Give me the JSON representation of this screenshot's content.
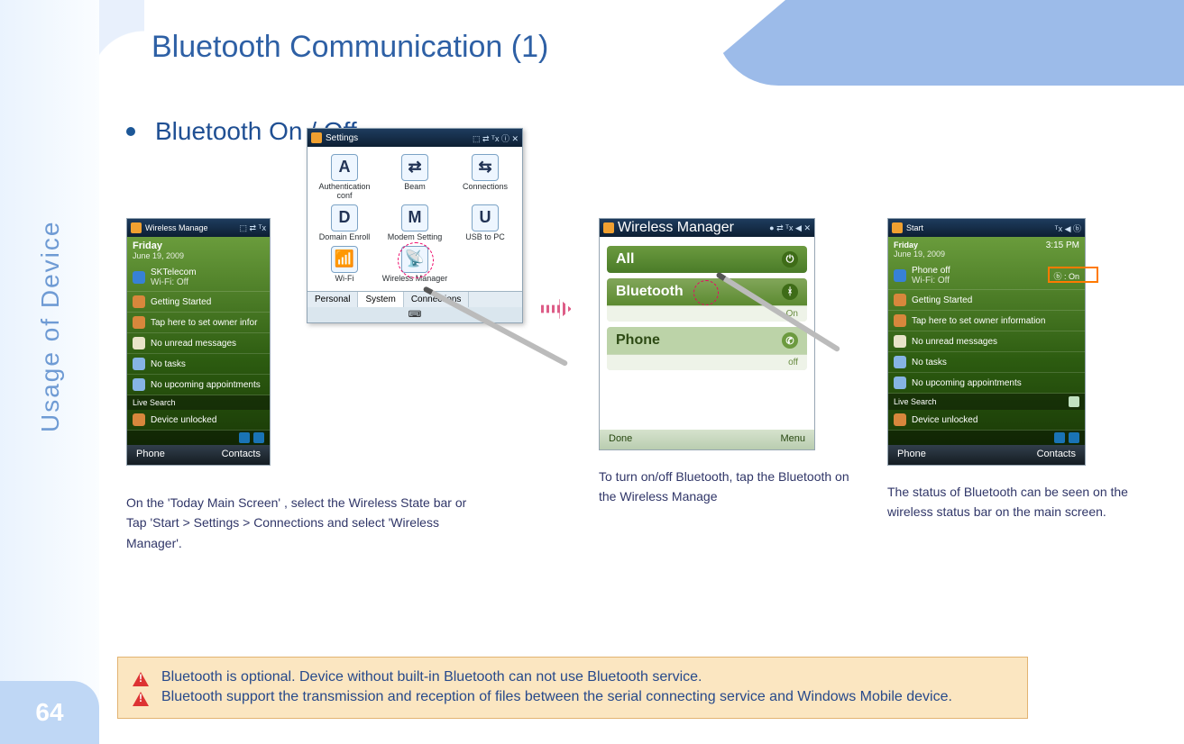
{
  "page": {
    "number": "64",
    "side_label": "Usage of Device",
    "title": "Bluetooth Communication (1)"
  },
  "bullet": "Bluetooth On / Off",
  "captions": {
    "c1": "On the 'Today Main Screen' , select the Wireless State bar or Tap 'Start > Settings > Connections and select 'Wireless Manager'.",
    "c2": "To turn on/off Bluetooth, tap the Bluetooth on the Wireless Manage",
    "c3": "The status of Bluetooth can be seen on the wireless status bar on the main screen."
  },
  "today1": {
    "title": "Wireless Manage",
    "date1": "Friday",
    "date2": "June 19, 2009",
    "carrier": "SKTelecom",
    "wifi": "Wi-Fi: Off",
    "rows": [
      "Getting Started",
      "Tap here to set owner infor",
      "No unread messages",
      "No tasks",
      "No upcoming appointments"
    ],
    "live": "Live Search",
    "unlock": "Device unlocked",
    "soft_l": "Phone",
    "soft_r": "Contacts"
  },
  "settings": {
    "title": "Settings",
    "items": [
      {
        "glyph": "A",
        "label": "Authentication conf"
      },
      {
        "glyph": "⇄",
        "label": "Beam"
      },
      {
        "glyph": "⇆",
        "label": "Connections"
      },
      {
        "glyph": "D",
        "label": "Domain Enroll"
      },
      {
        "glyph": "M",
        "label": "Modem Setting"
      },
      {
        "glyph": "U",
        "label": "USB to PC"
      },
      {
        "glyph": "📶",
        "label": "Wi-Fi"
      },
      {
        "glyph": "📡",
        "label": "Wireless Manager"
      }
    ],
    "tabs": [
      "Personal",
      "System",
      "Connections"
    ],
    "status_icons": "⬚ ⇄ ᵀx ⓘ ✕"
  },
  "wm": {
    "title": "Wireless Manager",
    "status_icons": "● ⇄ ᵀx ◀ ✕",
    "all": "All",
    "bt": "Bluetooth",
    "bt_state": "On",
    "ph": "Phone",
    "ph_state": "off",
    "soft_l": "Done",
    "soft_r": "Menu"
  },
  "today3": {
    "title": "Start",
    "time": "3:15 PM",
    "date1": "Friday",
    "date2": "June 19, 2009",
    "carrier": "Phone off",
    "wifi": "Wi-Fi: Off",
    "bt_badge": "ⓑ : On",
    "rows": [
      "Getting Started",
      "Tap here to set owner information",
      "No unread messages",
      "No tasks",
      "No upcoming appointments"
    ],
    "live": "Live Search",
    "unlock": "Device unlocked",
    "soft_l": "Phone",
    "soft_r": "Contacts"
  },
  "notes": {
    "n1": "Bluetooth is optional. Device without built-in Bluetooth can not use Bluetooth service.",
    "n2": "Bluetooth support the transmission and reception of files between the serial connecting service and Windows Mobile device."
  }
}
